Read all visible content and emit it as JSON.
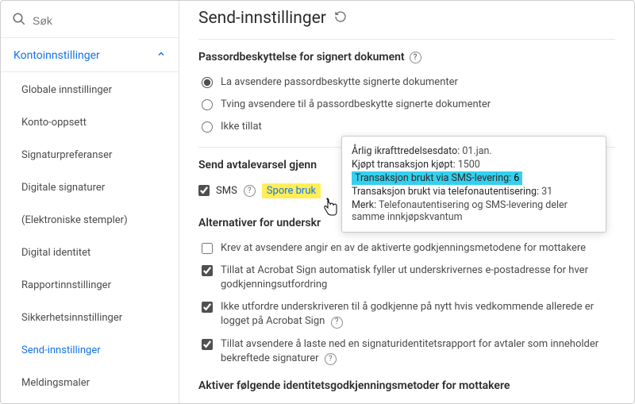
{
  "search": {
    "placeholder": "Søk"
  },
  "sidebar": {
    "section": "Kontoinnstillinger",
    "items": [
      "Globale innstillinger",
      "Konto-oppsett",
      "Signaturpreferanser",
      "Digitale signaturer",
      "(Elektroniske stempler)",
      "Digital identitet",
      "Rapportinnstillinger",
      "Sikkerhetsinnstillinger",
      "Send-innstillinger",
      "Meldingsmaler"
    ],
    "activeIndex": 8
  },
  "page": {
    "title": "Send-innstillinger"
  },
  "password_section": {
    "title": "Passordbeskyttelse for signert dokument",
    "options": [
      "La avsendere passordbeskytte signerte dokumenter",
      "Tving avsendere til å passordbeskytte signerte dokumenter",
      "Ikke tillat"
    ],
    "selectedIndex": 0
  },
  "sms_section": {
    "title": "Send avtalevarsel gjenn",
    "checkbox_label": "SMS",
    "track_link": "Spore bruk"
  },
  "tooltip": {
    "row1_label": "Årlig ikrafttredelsesdato:",
    "row1_value": "01.jan.",
    "row2_label": "Kjøpt transaksjon kjøpt:",
    "row2_value": "1500",
    "row3_label": "Transaksjon brukt via SMS-levering:",
    "row3_value": "6",
    "row4_label": "Transaksjon brukt via telefonautentisering:",
    "row4_value": "31",
    "row5_label": "Merk:",
    "row5_value": "Telefonautentisering og SMS-levering deler samme innkjøpskvantum"
  },
  "signer_options": {
    "title": "Alternativer for underskr",
    "items": [
      {
        "label": "Krev at avsendere angir en av de aktiverte godkjenningsmetodene for mottakere",
        "checked": false,
        "info": false
      },
      {
        "label": "Tillat at Acrobat Sign automatisk fyller ut underskrivernes e-postadresse for hver godkjenningsutfordring",
        "checked": true,
        "info": false
      },
      {
        "label": "Ikke utfordre underskriveren til å godkjenne på nytt hvis vedkommende allerede er logget på Acrobat Sign",
        "checked": true,
        "info": true
      },
      {
        "label": "Tillat avsendere å laste ned en signaturidentitetsrapport for avtaler som inneholder bekreftede signaturer",
        "checked": true,
        "info": true
      }
    ]
  },
  "bottom_section": {
    "title": "Aktiver følgende identitetsgodkjenningsmetoder for mottakere"
  }
}
